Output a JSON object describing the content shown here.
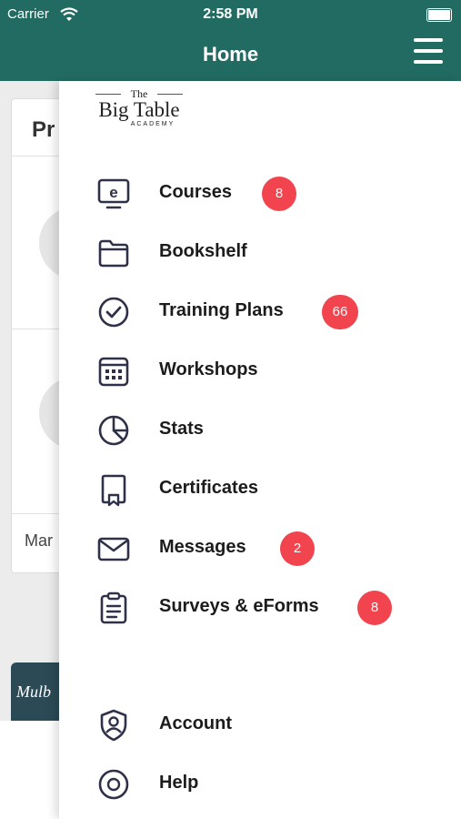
{
  "status_bar": {
    "carrier": "Carrier",
    "time": "2:58 PM"
  },
  "navbar": {
    "title": "Home"
  },
  "background_page": {
    "card_title": "Pr",
    "card_label": "Mar",
    "thumb_text": "Mulb"
  },
  "drawer": {
    "logo": {
      "the": "The",
      "name": "Big Table",
      "academy": "ACADEMY"
    },
    "items": [
      {
        "label": "Courses",
        "icon": "courses-icon",
        "badge": "8"
      },
      {
        "label": "Bookshelf",
        "icon": "folder-icon",
        "badge": ""
      },
      {
        "label": "Training Plans",
        "icon": "checkmark-circle-icon",
        "badge": "66"
      },
      {
        "label": "Workshops",
        "icon": "calendar-icon",
        "badge": ""
      },
      {
        "label": "Stats",
        "icon": "pie-chart-icon",
        "badge": ""
      },
      {
        "label": "Certificates",
        "icon": "certificate-icon",
        "badge": ""
      },
      {
        "label": "Messages",
        "icon": "envelope-icon",
        "badge": "2"
      },
      {
        "label": "Surveys & eForms",
        "icon": "clipboard-icon",
        "badge": "8"
      },
      {
        "label": "Account",
        "icon": "user-shield-icon",
        "badge": ""
      },
      {
        "label": "Help",
        "icon": "help-icon",
        "badge": ""
      }
    ]
  },
  "colors": {
    "header": "#226b63",
    "badge": "#f2444e",
    "icon_stroke": "#2f3148"
  }
}
